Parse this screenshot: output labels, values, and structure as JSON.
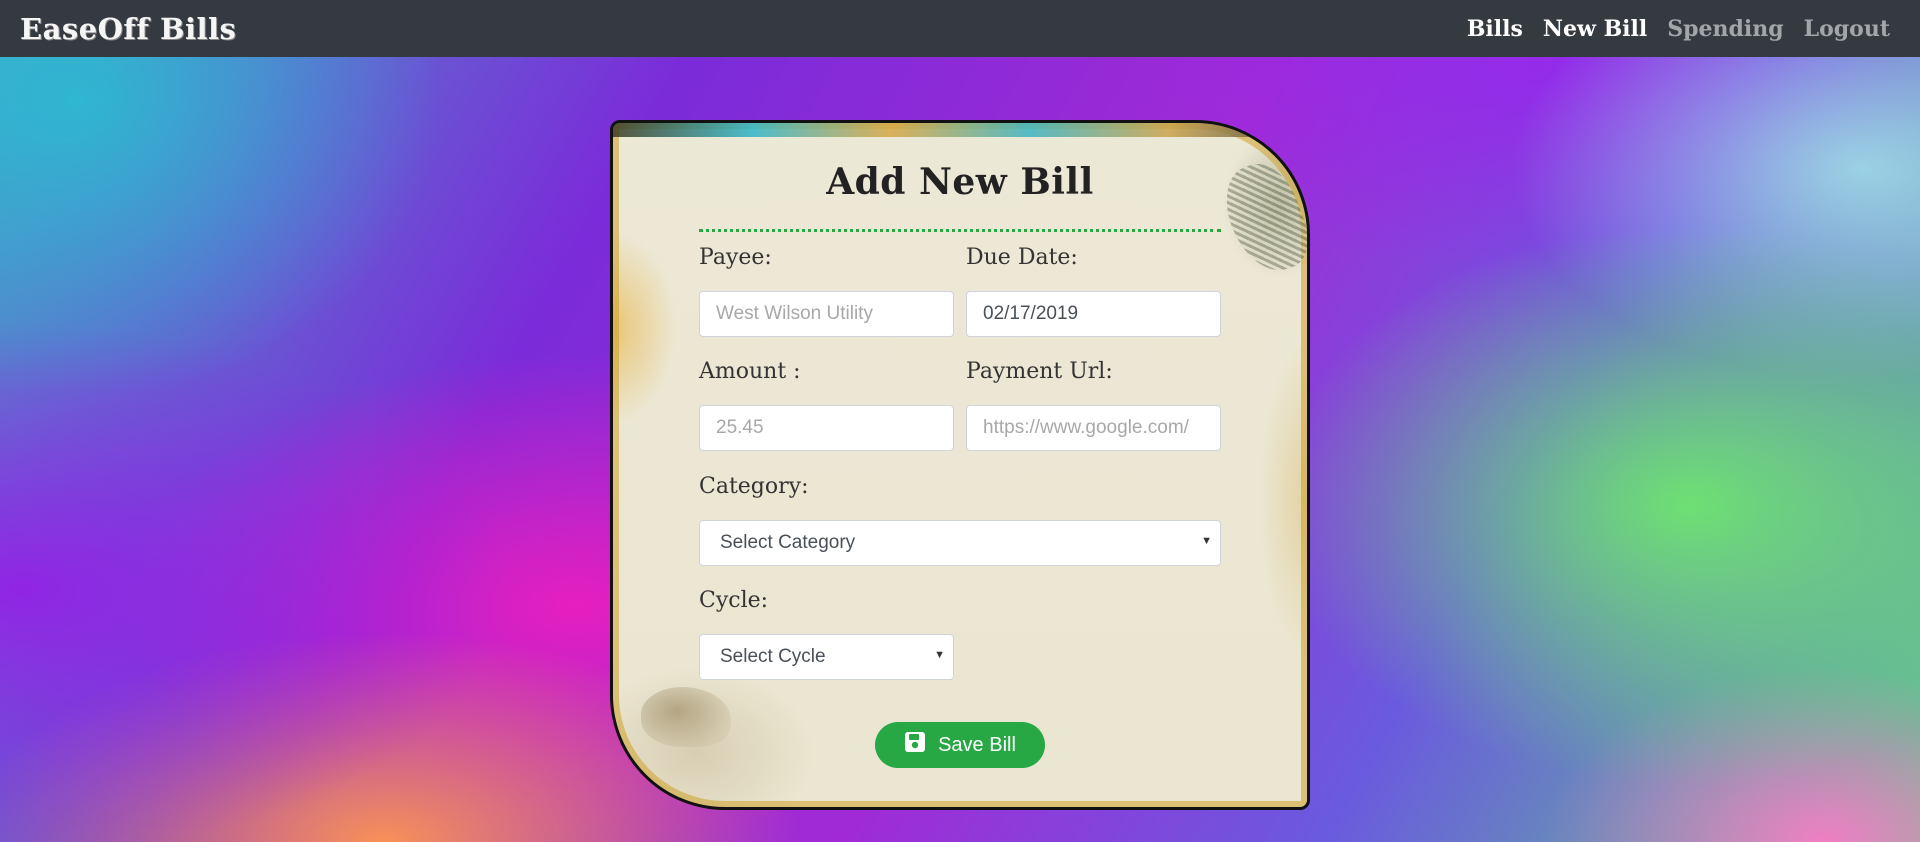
{
  "navbar": {
    "brand": "EaseOff Bills",
    "links": [
      {
        "label": "Bills",
        "active": true
      },
      {
        "label": "New Bill",
        "active": true
      },
      {
        "label": "Spending",
        "active": false
      },
      {
        "label": "Logout",
        "active": false
      }
    ]
  },
  "form": {
    "title": "Add New Bill",
    "payee": {
      "label": "Payee:",
      "placeholder": "West Wilson Utility",
      "value": ""
    },
    "due_date": {
      "label": "Due Date:",
      "value": "02/17/2019"
    },
    "amount": {
      "label": "Amount :",
      "placeholder": "25.45",
      "value": ""
    },
    "payment_url": {
      "label": "Payment Url:",
      "placeholder": "https://www.google.com/",
      "value": ""
    },
    "category": {
      "label": "Category:",
      "selected": "Select Category"
    },
    "cycle": {
      "label": "Cycle:",
      "selected": "Select Cycle"
    },
    "save_label": "Save Bill"
  },
  "icons": {
    "save": "floppy-disk-icon",
    "dropdown": "caret-down-icon"
  },
  "colors": {
    "navbar": "#343a40",
    "accent": "#28a745",
    "divider": "#28a745"
  }
}
